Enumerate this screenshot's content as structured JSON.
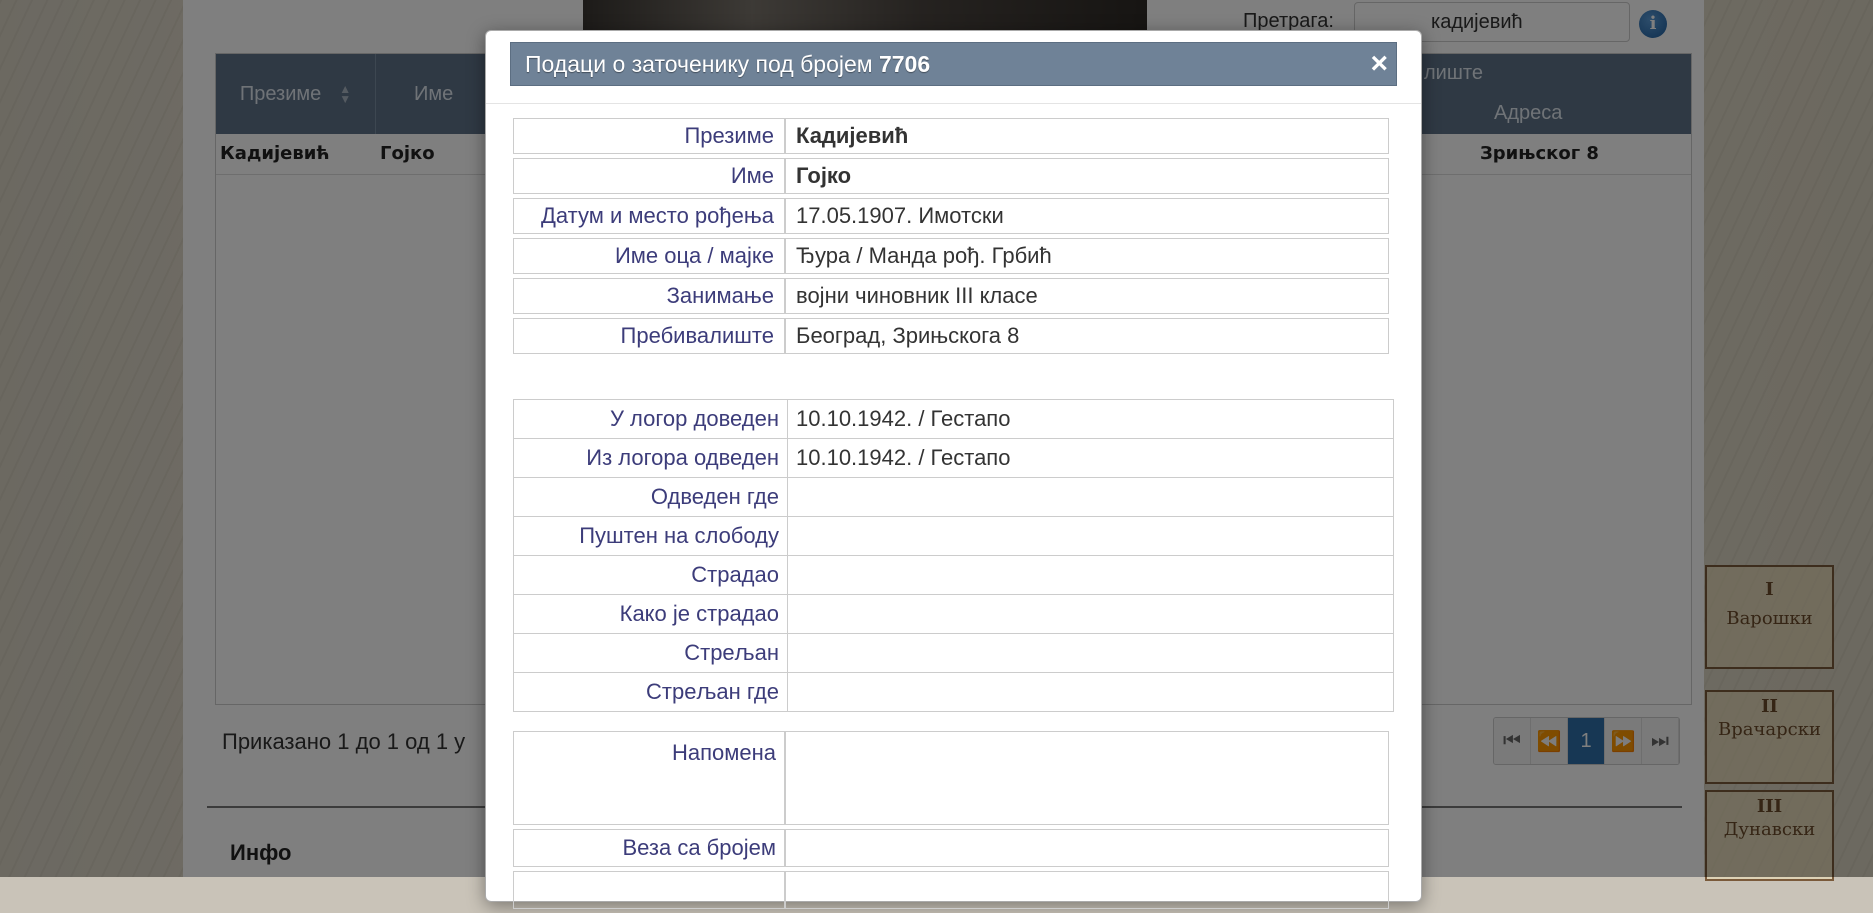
{
  "background_page": {
    "search": {
      "label": "Претрага:",
      "value": "кадијевић"
    },
    "grid": {
      "columns": [
        "Презиме",
        "Име"
      ],
      "right_headers": {
        "group": "лиште",
        "address": "Адреса"
      },
      "row": {
        "surname": "Кадијевић",
        "name": "Гојко",
        "address": "Зрињског 8"
      }
    },
    "footer_text": "Приказано 1 до 1 од 1 у",
    "pager": {
      "first": "⏮",
      "prev": "⏪",
      "current": "1",
      "next": "⏩",
      "last": "⏭"
    },
    "info_title": "Инфо",
    "map_stamps": [
      "I",
      "Варошки",
      "II",
      "Врачарски",
      "III",
      "Дунавски"
    ]
  },
  "modal": {
    "title_prefix": "Подаци о заточенику под бројем",
    "prisoner_number": "7706",
    "close": "×",
    "personal": [
      {
        "label": "Презиме",
        "value": "Кадијевић",
        "strong": true
      },
      {
        "label": "Име",
        "value": "Гојко",
        "strong": true
      },
      {
        "label": "Датум и место рођења",
        "value": "17.05.1907.  Имотски"
      },
      {
        "label": "Име оца / мајке",
        "value": "Ђура / Манда рођ. Грбић"
      },
      {
        "label": "Занимање",
        "value": "војни чиновник III класе"
      },
      {
        "label": "Пребивалиште",
        "value": "Београд, Зрињскога 8"
      }
    ],
    "camp": [
      {
        "label": "У логор доведен",
        "value": "10.10.1942. / Гестапо"
      },
      {
        "label": "Из логора одведен",
        "value": "10.10.1942. / Гестапо"
      },
      {
        "label": "Одведен где",
        "value": ""
      },
      {
        "label": "Пуштен на слободу",
        "value": ""
      },
      {
        "label": "Страдао",
        "value": ""
      },
      {
        "label": "Како је страдао",
        "value": ""
      },
      {
        "label": "Стрељан",
        "value": ""
      },
      {
        "label": "Стрељан где",
        "value": ""
      }
    ],
    "note": {
      "label": "Напомена",
      "value": ""
    },
    "link": {
      "label": "Веза са бројем",
      "value": ""
    }
  }
}
